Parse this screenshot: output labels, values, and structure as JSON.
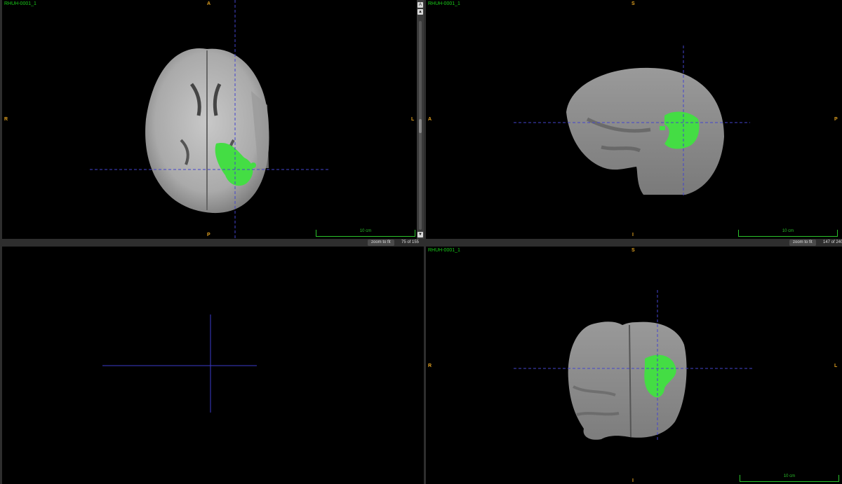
{
  "views": {
    "axial": {
      "volume": "RHUH-0001_1",
      "orient": {
        "top": "A",
        "bottom": "P",
        "left": "R",
        "right": "L"
      },
      "scale": "10 cm",
      "zoom_button": "zoom to fit",
      "slice": "75 of 155"
    },
    "sagittal": {
      "volume": "RHUH-0001_1",
      "orient": {
        "top": "S",
        "bottom": "I",
        "left": "A",
        "right": "P"
      },
      "scale": "10 cm",
      "zoom_button": "zoom to fit",
      "slice": "147 of 240"
    },
    "coronal": {
      "volume": "RHUH-0001_1",
      "orient": {
        "top": "S",
        "bottom": "I",
        "left": "R",
        "right": "L"
      },
      "scale": "10 cm"
    }
  },
  "scroll": {
    "up": "▲",
    "down": "▼",
    "zoom": "A"
  },
  "colors": {
    "segmentation": "#44dd44",
    "crosshair": "#4444cc",
    "orientation": "#e0a020",
    "label": "#19cc19"
  }
}
